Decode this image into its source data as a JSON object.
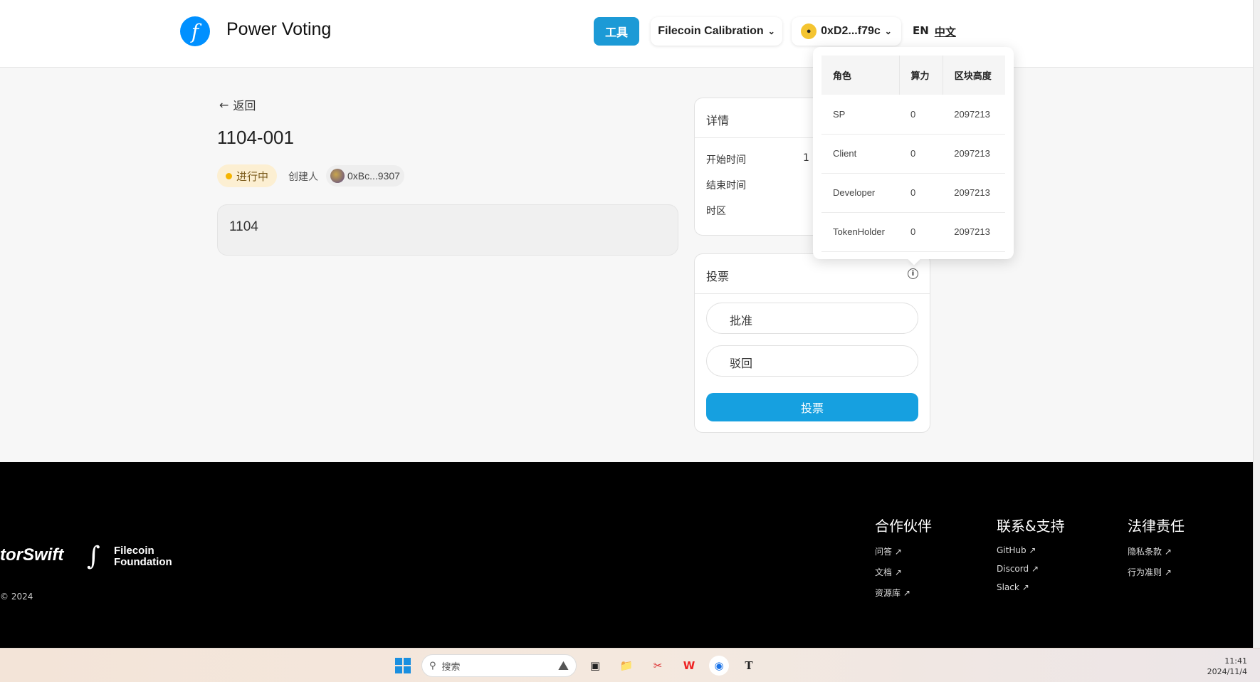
{
  "header": {
    "logo_glyph": "f",
    "title": "Power Voting",
    "tools_label": "工具",
    "network_label": "Filecoin Calibration",
    "wallet_label": "0xD2...f79c",
    "lang_en": "EN",
    "lang_zh": "中文"
  },
  "proposal": {
    "back_label": "返回",
    "title": "1104-001",
    "status": "进行中",
    "creator_label": "创建人",
    "creator_address": "0xBc...9307",
    "description": "1104"
  },
  "details": {
    "heading": "详情",
    "rows": [
      {
        "label": "开始时间",
        "value": "1"
      },
      {
        "label": "结束时间",
        "value": ""
      },
      {
        "label": "时区",
        "value": ""
      }
    ]
  },
  "vote": {
    "heading": "投票",
    "options": [
      "批准",
      "驳回"
    ],
    "submit_label": "投票"
  },
  "power_popover": {
    "columns": [
      "角色",
      "算力",
      "区块高度"
    ],
    "rows": [
      [
        "SP",
        "0",
        "2097213"
      ],
      [
        "Client",
        "0",
        "2097213"
      ],
      [
        "Developer",
        "0",
        "2097213"
      ],
      [
        "TokenHolder",
        "0",
        "2097213"
      ]
    ]
  },
  "footer": {
    "brand_partial": "torSwift",
    "foundation_line1": "Filecoin",
    "foundation_line2": "Foundation",
    "copyright": "© 2024",
    "columns": [
      {
        "title": "合作伙伴",
        "links": [
          "问答",
          "文档",
          "资源库"
        ]
      },
      {
        "title": "联系&支持",
        "links": [
          "GitHub",
          "Discord",
          "Slack"
        ]
      },
      {
        "title": "法律责任",
        "links": [
          "隐私条款",
          "行为准则"
        ]
      }
    ]
  },
  "taskbar": {
    "search_placeholder": "搜索",
    "time": "11:41",
    "date": "2024/11/4"
  },
  "colors": {
    "accent": "#16a0e0",
    "status_bg": "#fcefd2",
    "status_dot": "#f5b400"
  }
}
